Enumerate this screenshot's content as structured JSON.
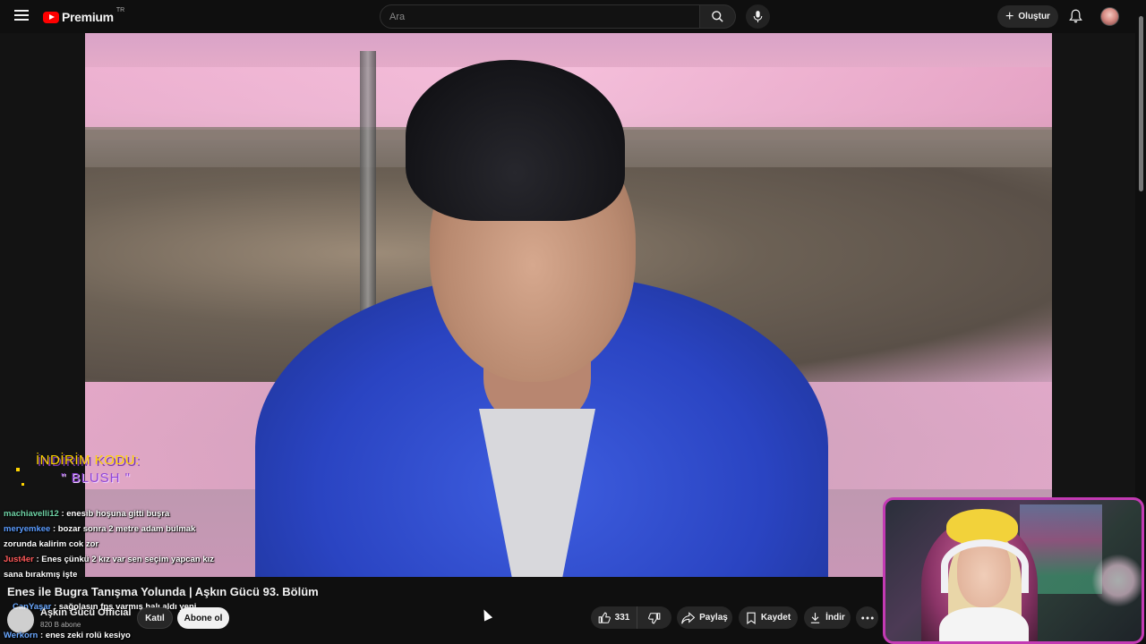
{
  "header": {
    "logo_text": "Premium",
    "logo_region": "TR",
    "search_placeholder": "Ara",
    "create_label": "Oluştur"
  },
  "video": {
    "title": "Enes ile Bugra Tanışma Yolunda | Aşkın Gücü 93. Bölüm",
    "promo_line1": "İNDİRİM KODU:",
    "promo_line2": "\" BLUSH \""
  },
  "channel": {
    "name": "Aşkın Gücü Official",
    "subscribers": "820 B abone",
    "join_label": "Katıl",
    "subscribe_label": "Abone ol"
  },
  "actions": {
    "like_count": "331",
    "share_label": "Paylaş",
    "save_label": "Kaydet",
    "download_label": "İndir"
  },
  "chat": [
    {
      "user": "machiavelli12",
      "color": "#6fd3a6",
      "msg": ": enesib hoşuna gitti buşra"
    },
    {
      "user": "meryemkee",
      "color": "#5b9cff",
      "msg": ": bozar sonra 2 metre adam bulmak zorunda kalirim cok zor"
    },
    {
      "user": "Just4er",
      "color": "#ff5a5a",
      "msg": ": Enes çünkü 2 kız var sen seçim yapcan kız sana bırakmış işte"
    },
    {
      "user": "CanYaşar",
      "color": "#6aa8ff",
      "msg": ": sağolasın fps varmış halı aldı yeni"
    },
    {
      "user": "Werkorn",
      "color": "#6aa8ff",
      "msg": ": enes zeki rolü kesiyo"
    }
  ],
  "colors": {
    "background": "#0f0f0f",
    "accent_red": "#ff0000",
    "cam_border": "#c33ab3",
    "promo_yellow": "#ffd400",
    "promo_purple": "#8f45d6"
  }
}
